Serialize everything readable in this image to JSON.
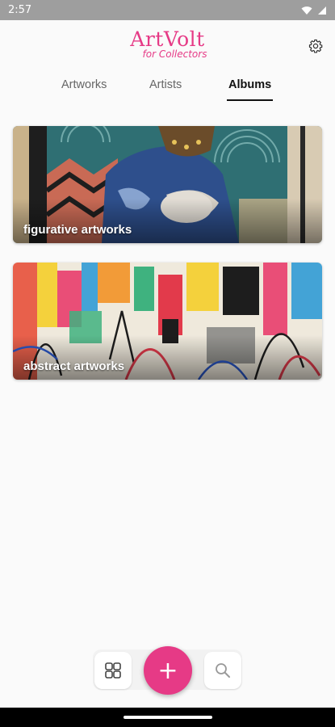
{
  "status_bar": {
    "time": "2:57",
    "wifi_icon": "wifi-icon",
    "signal_icon": "cell-signal-icon"
  },
  "app": {
    "title": "ArtVolt",
    "subtitle": "for Collectors",
    "brand_color": "#e63a86"
  },
  "header": {
    "settings_icon": "gear-icon"
  },
  "tabs": [
    {
      "label": "Artworks",
      "active": false
    },
    {
      "label": "Artists",
      "active": false
    },
    {
      "label": "Albums",
      "active": true
    }
  ],
  "albums": [
    {
      "label": "figurative artworks",
      "image": "figurative-mural-thumbnail"
    },
    {
      "label": "abstract artworks",
      "image": "abstract-graffiti-thumbnail"
    }
  ],
  "bottom_nav": {
    "grid_icon": "grid-icon",
    "add_label": "+",
    "search_icon": "search-icon"
  }
}
